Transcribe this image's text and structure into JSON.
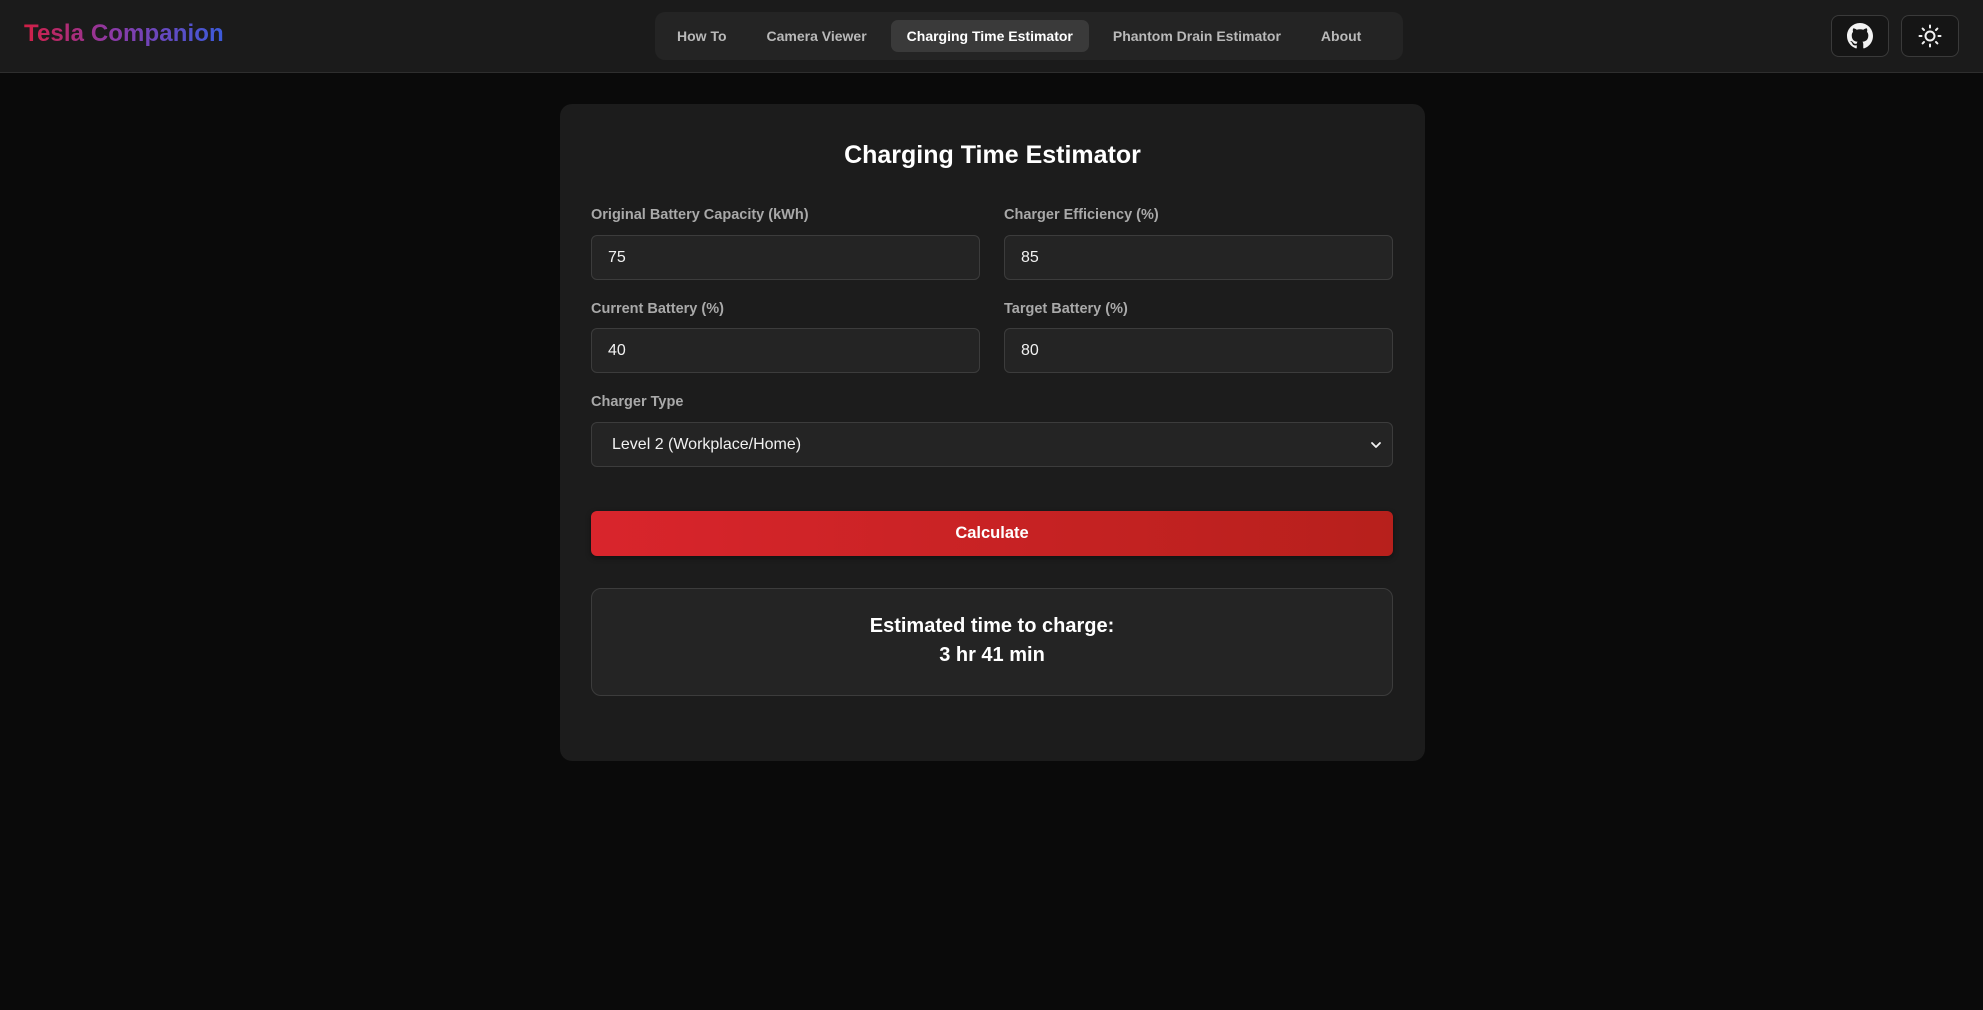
{
  "brand": {
    "name": "Tesla Companion"
  },
  "nav": {
    "items": [
      {
        "label": "How To"
      },
      {
        "label": "Camera Viewer"
      },
      {
        "label": "Charging Time Estimator",
        "active": true
      },
      {
        "label": "Phantom Drain Estimator"
      },
      {
        "label": "About"
      }
    ]
  },
  "header_icons": {
    "github": "github-icon",
    "theme": "sun-icon"
  },
  "form": {
    "title": "Charging Time Estimator",
    "battery_capacity": {
      "label": "Original Battery Capacity (kWh)",
      "value": "75"
    },
    "charger_efficiency": {
      "label": "Charger Efficiency (%)",
      "value": "85"
    },
    "current_battery": {
      "label": "Current Battery (%)",
      "value": "40"
    },
    "target_battery": {
      "label": "Target Battery (%)",
      "value": "80"
    },
    "charger_type": {
      "label": "Charger Type",
      "selected": "Level 2 (Workplace/Home)"
    },
    "calculate_label": "Calculate"
  },
  "result": {
    "label": "Estimated time to charge:",
    "value": "3 hr 41 min"
  },
  "colors": {
    "accent": "#d9252c",
    "brand_gradient_start": "#d11f45",
    "brand_gradient_end": "#3b5bdb",
    "background": "#0a0a0a",
    "card": "#1c1c1c"
  }
}
